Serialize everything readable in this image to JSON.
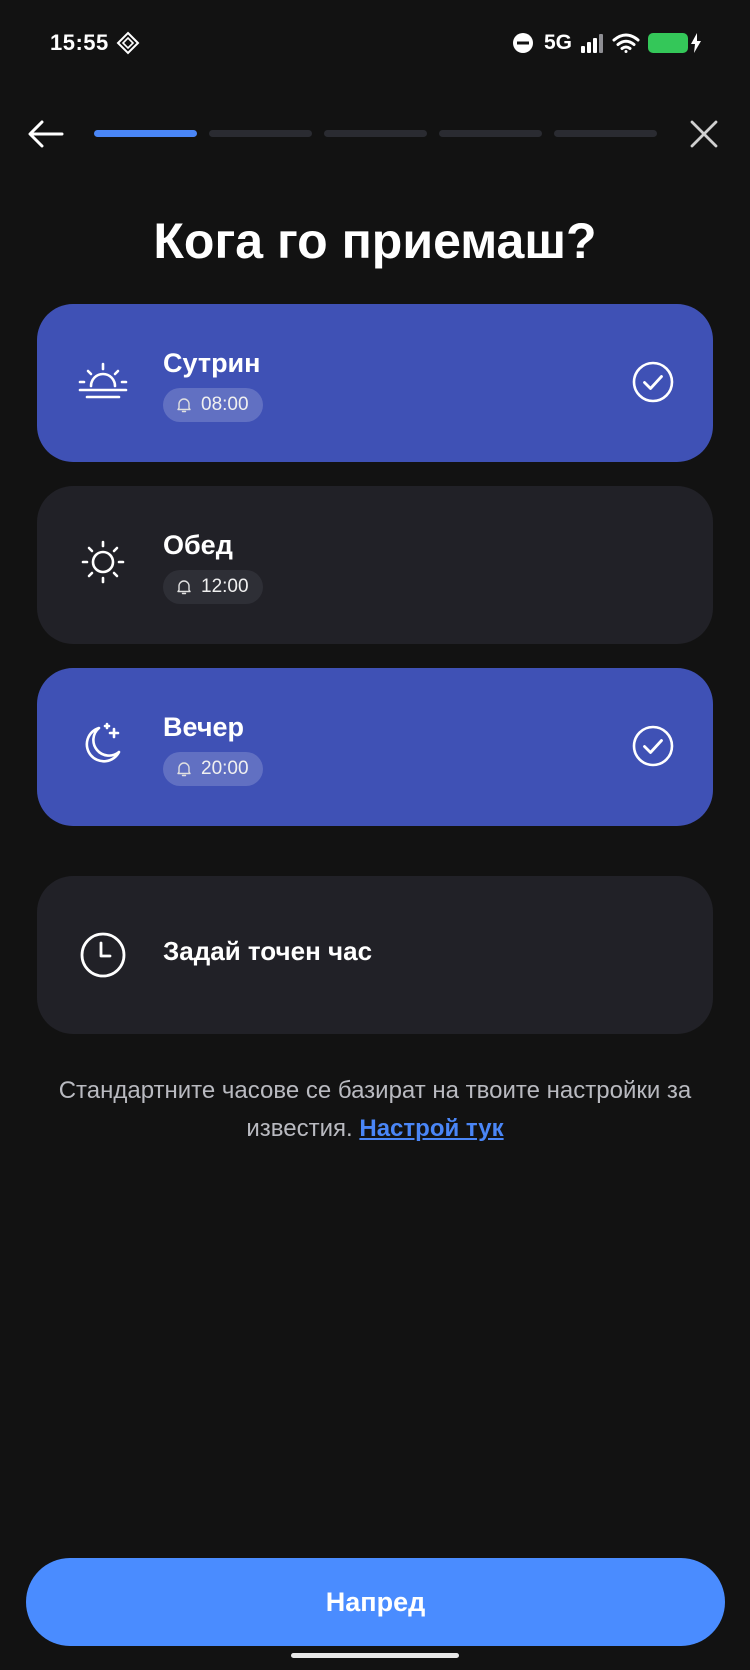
{
  "status": {
    "time": "15:55",
    "network": "5G",
    "battery_color": "#34c759"
  },
  "nav": {
    "back_icon": "arrow-left-icon",
    "close_icon": "close-icon",
    "steps_total": 5,
    "steps_current": 1
  },
  "title": "Кога го приемаш?",
  "options": [
    {
      "label": "Сутрин",
      "time": "08:00",
      "icon": "sunrise-icon",
      "selected": true
    },
    {
      "label": "Обед",
      "time": "12:00",
      "icon": "sun-icon",
      "selected": false
    },
    {
      "label": "Вечер",
      "time": "20:00",
      "icon": "moon-stars-icon",
      "selected": true
    }
  ],
  "custom": {
    "label": "Задай точен час",
    "icon": "clock-icon"
  },
  "note": {
    "text": "Стандартните часове се базират на твоите настройки за известия.",
    "link": "Настрой тук"
  },
  "primary_button": "Напред",
  "colors": {
    "background": "#121212",
    "card": "#212127",
    "card_selected": "#3f51b5",
    "accent": "#4a8cff",
    "progress_active": "#4a86f7"
  }
}
